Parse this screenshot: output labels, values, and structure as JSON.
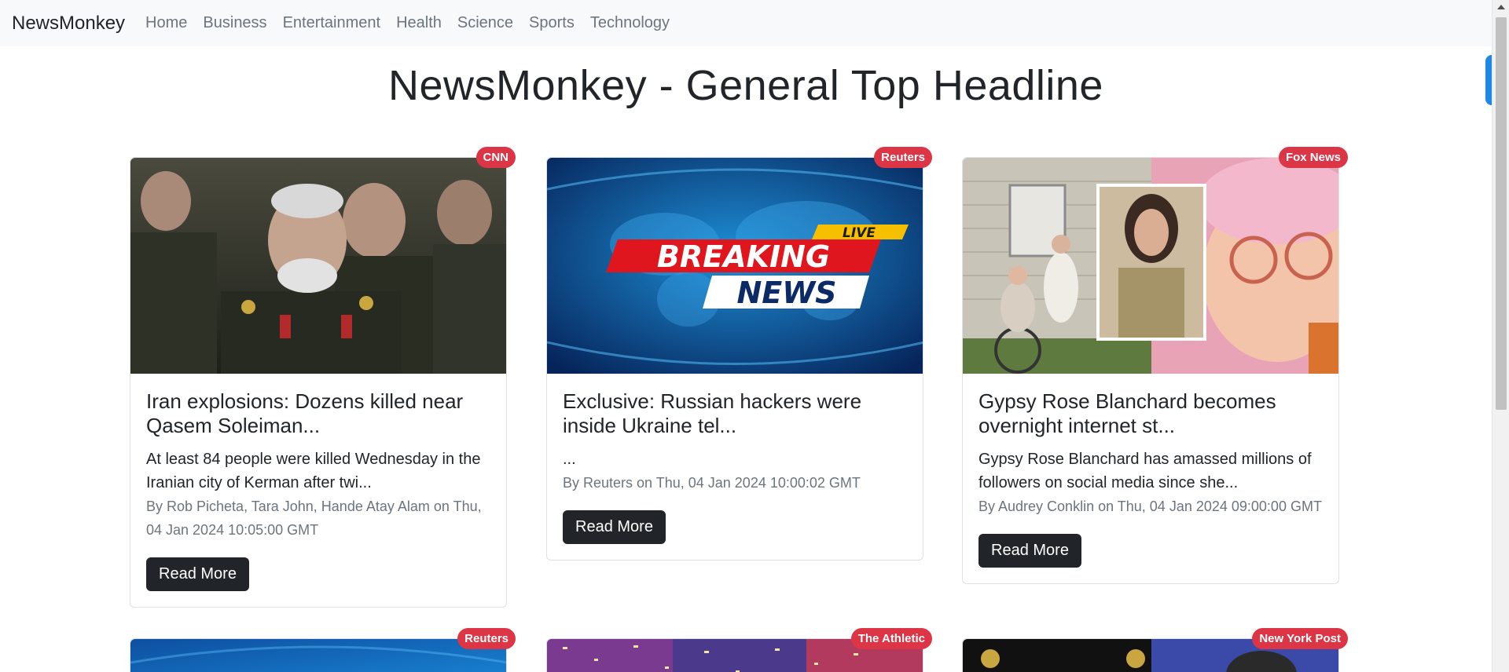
{
  "nav": {
    "brand": "NewsMonkey",
    "links": [
      "Home",
      "Business",
      "Entertainment",
      "Health",
      "Science",
      "Sports",
      "Technology"
    ]
  },
  "page_title": "NewsMonkey - General Top Headline",
  "colors": {
    "badge": "#dc3545",
    "button": "#212529",
    "navbar_bg": "#f8f9fa",
    "accent_tab": "#1e88e5"
  },
  "cards": [
    {
      "source": "CNN",
      "image": "photo of military officers in uniform",
      "title": "Iran explosions: Dozens killed near Qasem Soleiman...",
      "description": "At least 84 people were killed Wednesday in the Iranian city of Kerman after twi...",
      "meta": "By Rob Picheta, Tara John, Hande Atay Alam on Thu, 04 Jan 2024 10:05:00 GMT",
      "button": "Read More"
    },
    {
      "source": "Reuters",
      "image": "breaking news graphic",
      "image_text": {
        "live": "LIVE",
        "line1": "BREAKING",
        "line2": "NEWS"
      },
      "title": "Exclusive: Russian hackers were inside Ukraine tel...",
      "description": "...",
      "meta": "By Reuters on Thu, 04 Jan 2024 10:00:02 GMT",
      "button": "Read More"
    },
    {
      "source": "Fox News",
      "image": "photo collage of woman",
      "title": "Gypsy Rose Blanchard becomes overnight internet st...",
      "description": "Gypsy Rose Blanchard has amassed millions of followers on social media since she...",
      "meta": "By Audrey Conklin on Thu, 04 Jan 2024 09:00:00 GMT",
      "button": "Read More"
    },
    {
      "source": "Reuters"
    },
    {
      "source": "The Athletic"
    },
    {
      "source": "New York Post"
    }
  ]
}
